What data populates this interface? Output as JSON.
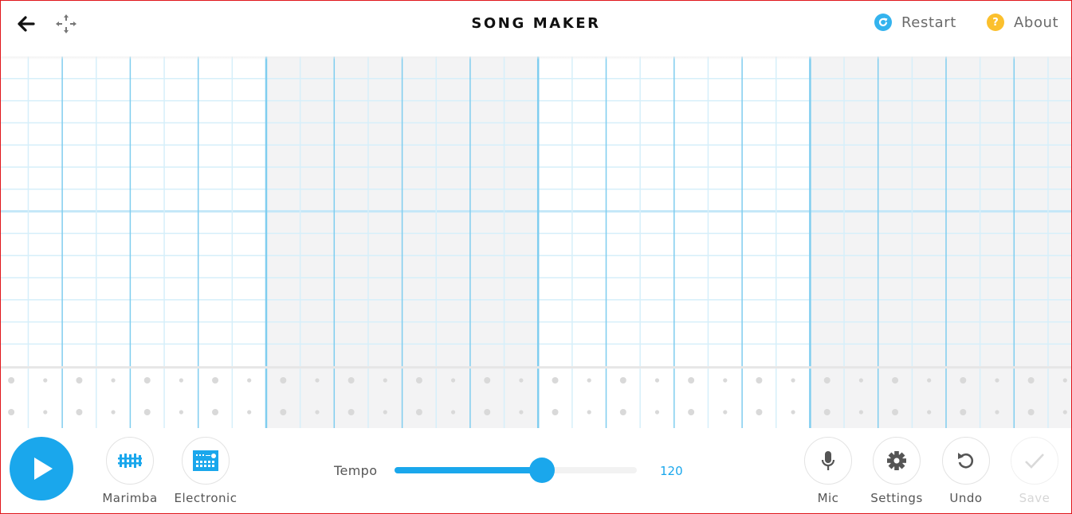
{
  "header": {
    "title": "SONG MAKER",
    "back_icon": "arrow-left-icon",
    "move_icon": "move-arrows-icon",
    "restart": {
      "label": "Restart",
      "icon": "refresh-icon",
      "color": "#34b3ee"
    },
    "about": {
      "label": "About",
      "icon": "question-icon",
      "glyph": "?",
      "color": "#fbc02d"
    }
  },
  "grid": {
    "bars": 4,
    "beats_per_bar": 4,
    "subdivisions_per_beat": 2,
    "melody_rows": 14,
    "octave_divider_after_row": 7,
    "rhythm_rows": 2,
    "notes": [],
    "colors": {
      "line_light": "#d6effa",
      "line_beat": "#a9dcf3",
      "line_bar": "#7fcdef",
      "bar_alt_bg": "#f3f3f4",
      "dot": "#d9d9d9",
      "separator": "#e6e6e6"
    }
  },
  "controls": {
    "play": {
      "icon": "play-icon",
      "color": "#1aa7ec"
    },
    "instruments": [
      {
        "label": "Marimba",
        "icon": "marimba-icon"
      },
      {
        "label": "Electronic",
        "icon": "drum-machine-icon"
      }
    ],
    "tempo": {
      "label": "Tempo",
      "value": "120",
      "fraction": 0.61
    },
    "actions": [
      {
        "label": "Mic",
        "icon": "microphone-icon",
        "enabled": true
      },
      {
        "label": "Settings",
        "icon": "gear-icon",
        "enabled": true
      },
      {
        "label": "Undo",
        "icon": "undo-icon",
        "enabled": true
      },
      {
        "label": "Save",
        "icon": "checkmark-icon",
        "enabled": false
      }
    ]
  }
}
